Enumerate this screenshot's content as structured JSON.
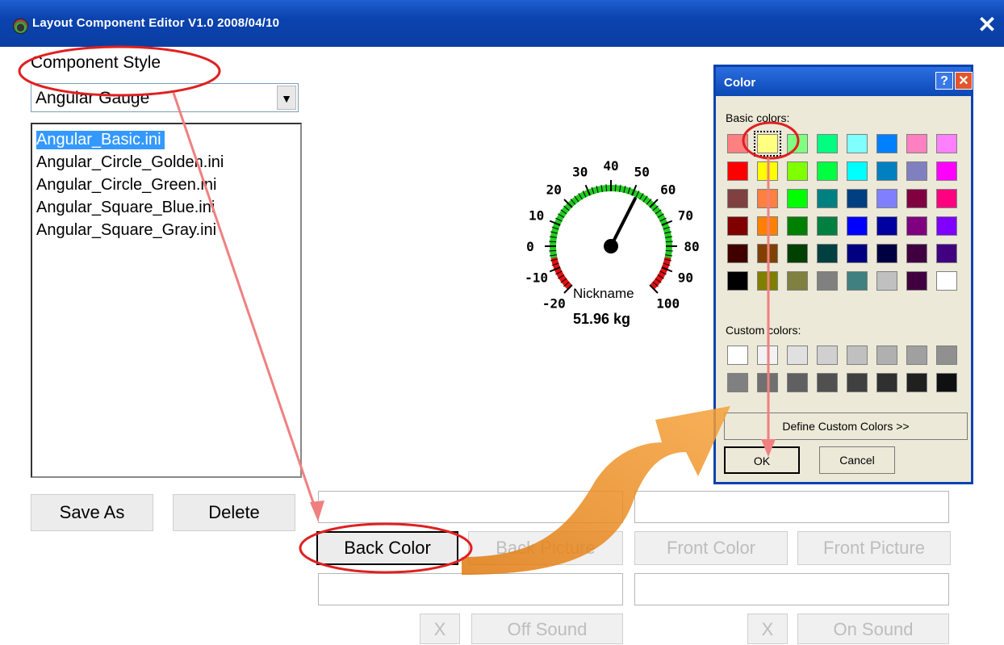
{
  "window": {
    "title": "Layout Component Editor V1.0  2008/04/10",
    "close_label": "✕"
  },
  "component_style": {
    "label": "Component Style",
    "selected": "Angular Gauge"
  },
  "style_files": [
    "Angular_Basic.ini",
    "Angular_Circle_Golden.ini",
    "Angular_Circle_Green.ini",
    "Angular_Square_Blue.ini",
    "Angular_Square_Gray.ini"
  ],
  "buttons": {
    "save_as": "Save As",
    "delete": "Delete",
    "back_color": "Back Color",
    "back_picture": "Back Picture",
    "front_color": "Front Color",
    "front_picture": "Front Picture",
    "x_off": "X",
    "off_sound": "Off Sound",
    "x_on": "X",
    "on_sound": "On Sound"
  },
  "gauge": {
    "ticks": [
      "-20",
      "-10",
      "0",
      "10",
      "20",
      "30",
      "40",
      "50",
      "60",
      "70",
      "80",
      "90",
      "100"
    ],
    "nickname": "Nickname",
    "value": "51.96 kg",
    "needle_value": 51.96,
    "min": -20,
    "max": 100
  },
  "color_dialog": {
    "title": "Color",
    "help": "?",
    "close": "✕",
    "basic_label": "Basic colors:",
    "custom_label": "Custom colors:",
    "define_custom": "Define Custom Colors >>",
    "ok": "OK",
    "cancel": "Cancel",
    "basic_colors": [
      "#ff8080",
      "#ffff80",
      "#80ff80",
      "#00ff80",
      "#80ffff",
      "#0080ff",
      "#ff80c0",
      "#ff80ff",
      "#ff0000",
      "#ffff00",
      "#80ff00",
      "#00ff40",
      "#00ffff",
      "#0080c0",
      "#8080c0",
      "#ff00ff",
      "#804040",
      "#ff8040",
      "#00ff00",
      "#008080",
      "#004080",
      "#8080ff",
      "#800040",
      "#ff0080",
      "#800000",
      "#ff8000",
      "#008000",
      "#008040",
      "#0000ff",
      "#0000a0",
      "#800080",
      "#8000ff",
      "#400000",
      "#804000",
      "#004000",
      "#004040",
      "#000080",
      "#000040",
      "#400040",
      "#400080",
      "#000000",
      "#808000",
      "#808040",
      "#808080",
      "#408080",
      "#c0c0c0",
      "#400040",
      "#ffffff"
    ],
    "selected_index": 1,
    "custom_colors": [
      "#ffffff",
      "#f2f2f2",
      "#e0e0e0",
      "#d0d0d0",
      "#c0c0c0",
      "#b0b0b0",
      "#a0a0a0",
      "#909090",
      "#808080",
      "#707070",
      "#606060",
      "#505050",
      "#404040",
      "#303030",
      "#202020",
      "#101010"
    ]
  }
}
